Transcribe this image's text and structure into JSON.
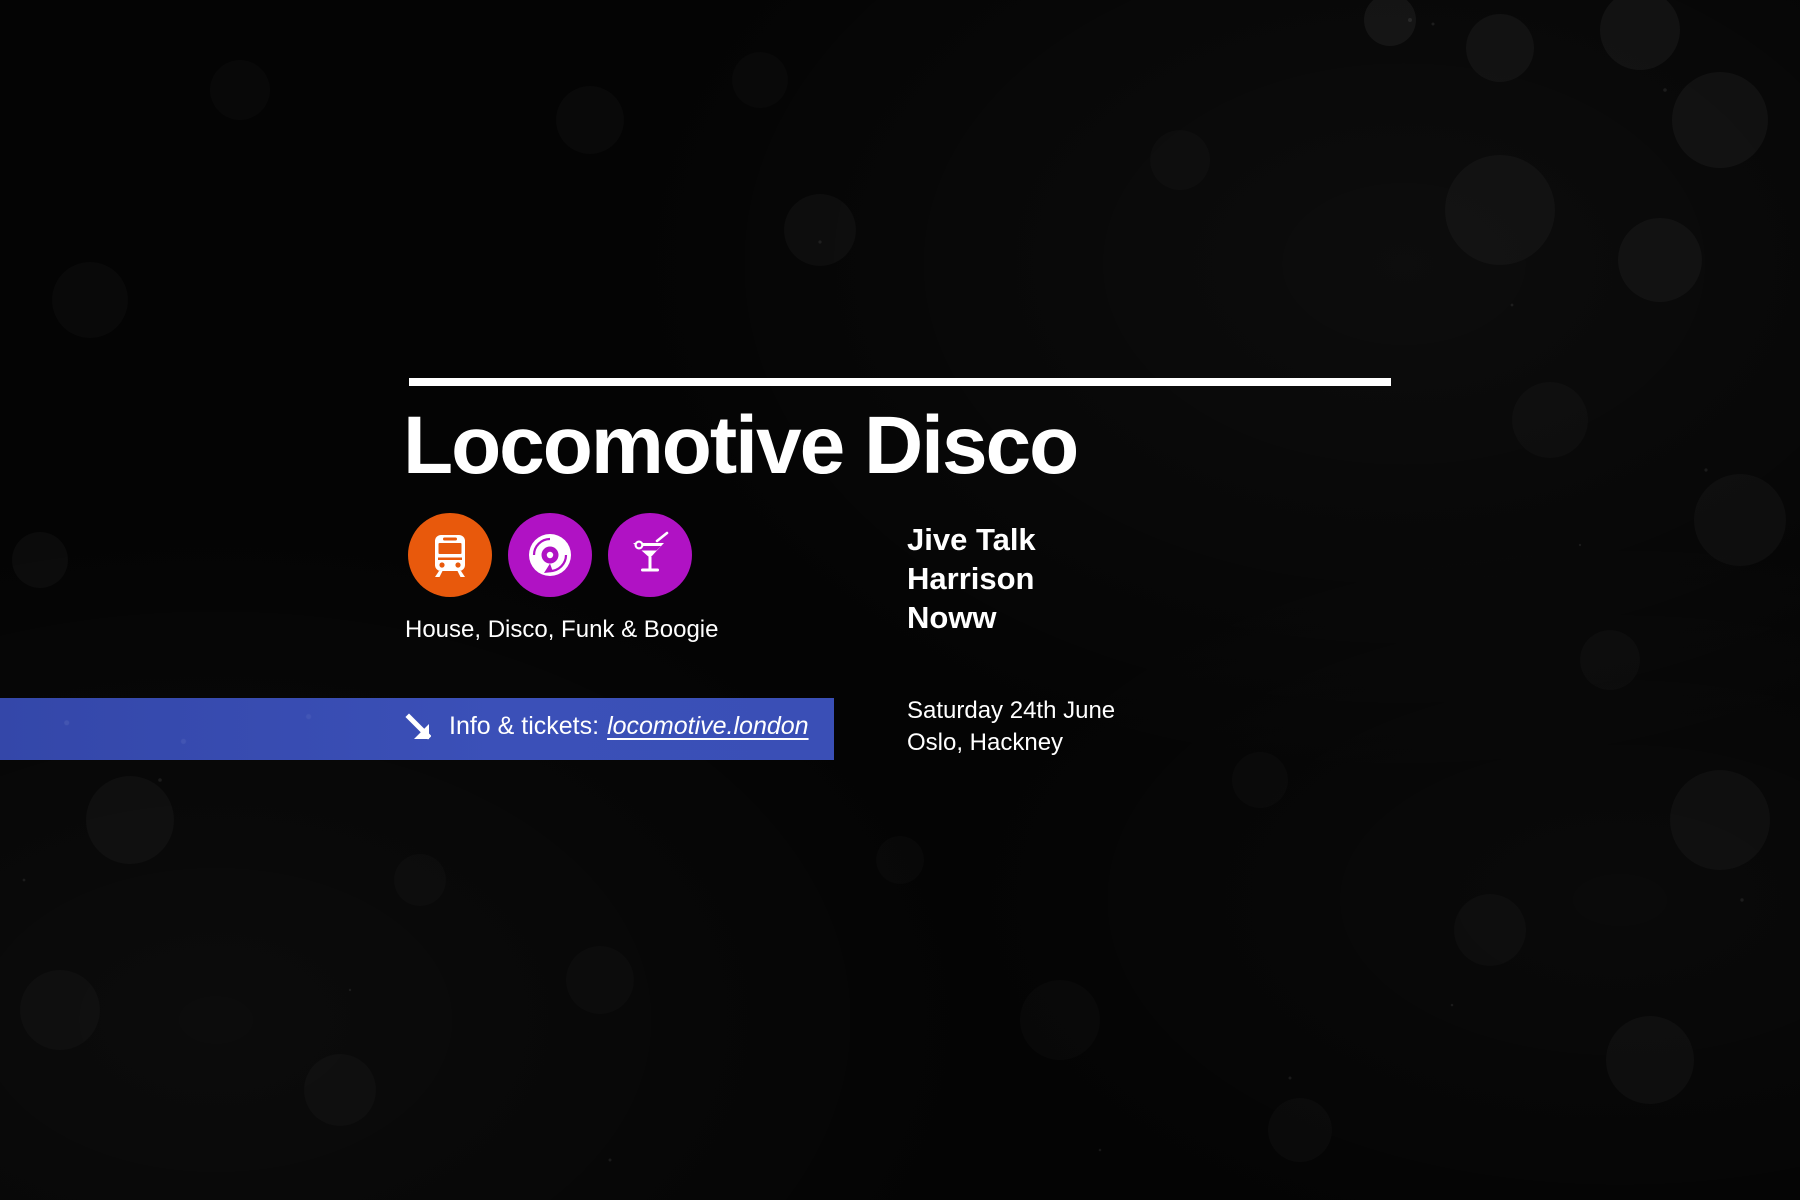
{
  "event": {
    "title": "Locomotive Disco",
    "genres": "House, Disco, Funk & Boogie",
    "lineup": [
      "Jive Talk",
      "Harrison",
      "Noww"
    ],
    "date": "Saturday 24th June",
    "venue": "Oslo, Hackney"
  },
  "tickets": {
    "label": "Info & tickets:",
    "link_text": "locomotive.london"
  },
  "icons": [
    {
      "name": "train-icon",
      "color": "#e8590c"
    },
    {
      "name": "vinyl-record-icon",
      "color": "#b012c4"
    },
    {
      "name": "cocktail-icon",
      "color": "#b012c4"
    }
  ],
  "colors": {
    "background": "#040404",
    "text": "#ffffff",
    "ticket_bar": "#3a4fb5",
    "train_orange": "#e8590c",
    "magenta": "#b012c4"
  }
}
